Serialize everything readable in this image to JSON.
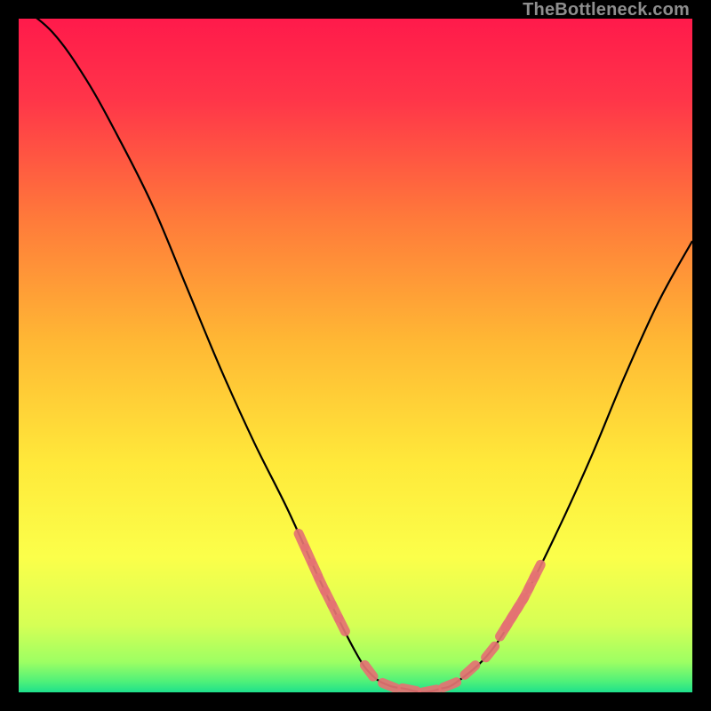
{
  "watermark": "TheBottleneck.com",
  "chart_data": {
    "type": "line",
    "title": "",
    "xlabel": "",
    "ylabel": "",
    "xlim": [
      0,
      1
    ],
    "ylim": [
      0,
      1
    ],
    "x": [
      0.0,
      0.05,
      0.1,
      0.15,
      0.2,
      0.25,
      0.3,
      0.35,
      0.4,
      0.45,
      0.5,
      0.525,
      0.55,
      0.575,
      0.6,
      0.625,
      0.65,
      0.7,
      0.75,
      0.8,
      0.85,
      0.9,
      0.95,
      1.0
    ],
    "values": [
      1.02,
      0.98,
      0.91,
      0.82,
      0.72,
      0.6,
      0.48,
      0.37,
      0.27,
      0.16,
      0.06,
      0.025,
      0.01,
      0.005,
      0.0,
      0.005,
      0.015,
      0.06,
      0.14,
      0.24,
      0.35,
      0.47,
      0.58,
      0.67
    ],
    "highlight_ranges": [
      {
        "x_start": 0.42,
        "x_end": 0.48
      },
      {
        "x_start": 0.52,
        "x_end": 0.7
      },
      {
        "x_start": 0.72,
        "x_end": 0.77
      }
    ],
    "gradient_stops": [
      {
        "offset": 0.0,
        "color": "#ff1a4b"
      },
      {
        "offset": 0.12,
        "color": "#ff3549"
      },
      {
        "offset": 0.3,
        "color": "#ff7b3a"
      },
      {
        "offset": 0.48,
        "color": "#ffb834"
      },
      {
        "offset": 0.66,
        "color": "#ffe93a"
      },
      {
        "offset": 0.8,
        "color": "#fbff4a"
      },
      {
        "offset": 0.9,
        "color": "#d6ff55"
      },
      {
        "offset": 0.955,
        "color": "#9dff63"
      },
      {
        "offset": 0.985,
        "color": "#4cf07a"
      },
      {
        "offset": 1.0,
        "color": "#1ee08c"
      }
    ],
    "highlight_color": "#e57373",
    "curve_color": "#000000"
  }
}
